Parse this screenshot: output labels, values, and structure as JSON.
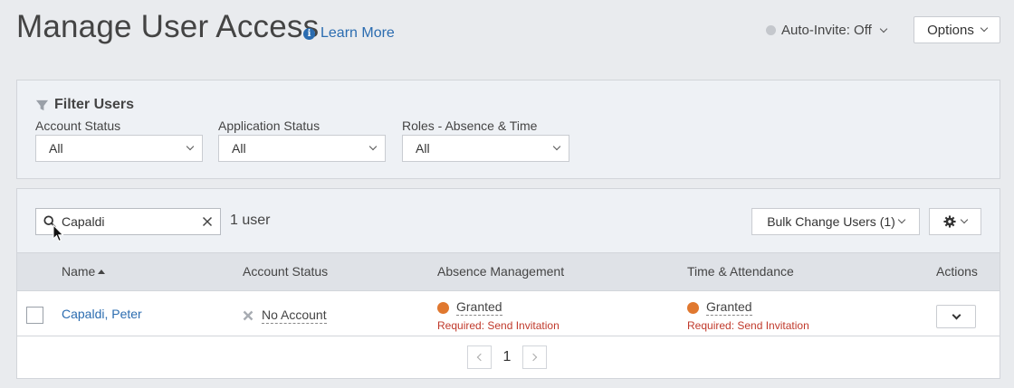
{
  "header": {
    "title": "Manage User Access",
    "learn_more": "Learn More",
    "auto_invite": "Auto-Invite: Off",
    "options_label": "Options"
  },
  "filter": {
    "title": "Filter Users",
    "groups": [
      {
        "label": "Account Status",
        "value": "All"
      },
      {
        "label": "Application Status",
        "value": "All"
      },
      {
        "label": "Roles - Absence & Time",
        "value": "All"
      }
    ]
  },
  "toolbar": {
    "search_value": "Capaldi",
    "user_count": "1 user",
    "bulk_label": "Bulk Change Users (1)"
  },
  "table": {
    "headers": {
      "name": "Name",
      "account_status": "Account Status",
      "absence": "Absence Management",
      "time": "Time & Attendance",
      "actions": "Actions"
    },
    "rows": [
      {
        "name": "Capaldi, Peter",
        "account_status": "No Account",
        "absence_status": "Granted",
        "absence_required": "Required: Send Invitation",
        "time_status": "Granted",
        "time_required": "Required: Send Invitation"
      }
    ]
  },
  "pagination": {
    "current_page": "1"
  },
  "colors": {
    "link": "#2b6cb0",
    "granted_dot": "#e0782f",
    "required_text": "#c0392b"
  }
}
